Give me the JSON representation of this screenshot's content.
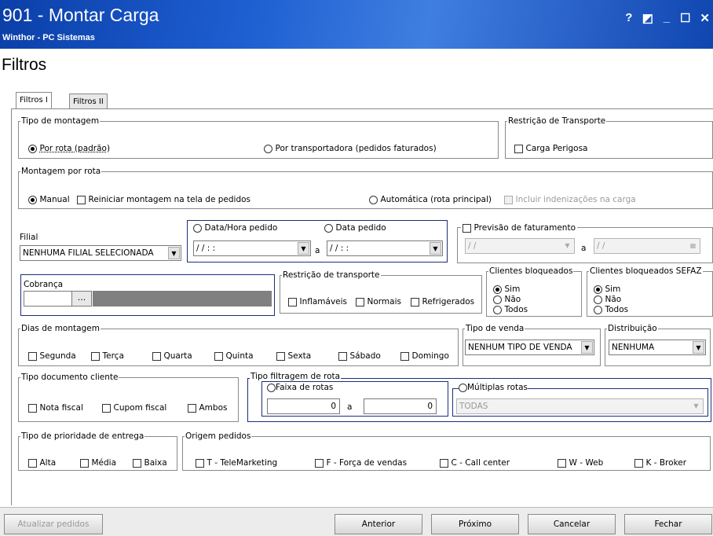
{
  "window": {
    "title": "901 - Montar Carga",
    "subtitle": "Winthor - PC Sistemas",
    "controls": [
      "?",
      "◩",
      "_",
      "☐",
      "✕"
    ]
  },
  "page_title": "Filtros",
  "tabs": [
    "Filtros I",
    "Filtros II"
  ],
  "tipo_montagem": {
    "legend": "Tipo de montagem",
    "opt_rota": "Por rota (padrão)",
    "opt_transp": "Por transportadora (pedidos faturados)"
  },
  "restricao_transporte_top": {
    "legend": "Restrição de Transporte",
    "carga_perigosa": "Carga Perigosa"
  },
  "montagem_rota": {
    "legend": "Montagem por rota",
    "manual": "Manual",
    "reiniciar": "Reiniciar montagem na tela de pedidos",
    "automatica": "Automática (rota principal)",
    "incluir": "Incluir indenizações na carga"
  },
  "filial": {
    "label": "Filial",
    "value": "NENHUMA FILIAL SELECIONADA"
  },
  "data": {
    "opt_datahora": "Data/Hora pedido",
    "opt_data": "Data pedido",
    "from": "/ /   : :",
    "to": "/ /   : :",
    "a": "a"
  },
  "previsao": {
    "label": "Previsão de faturamento",
    "from": "/ /",
    "to": "/ /",
    "a": "a"
  },
  "cobranca": {
    "label": "Cobrança",
    "button": "..."
  },
  "restricao_transporte": {
    "legend": "Restrição de transporte",
    "inflamaveis": "Inflamáveis",
    "normais": "Normais",
    "refrigerados": "Refrigerados"
  },
  "clientes_bloq": {
    "legend": "Clientes bloqueados",
    "sim": "Sim",
    "nao": "Não",
    "todos": "Todos"
  },
  "clientes_bloq_sefaz": {
    "legend": "Clientes bloqueados SEFAZ",
    "sim": "Sim",
    "nao": "Não",
    "todos": "Todos"
  },
  "dias": {
    "legend": "Dias de montagem",
    "items": [
      "Segunda",
      "Terça",
      "Quarta",
      "Quinta",
      "Sexta",
      "Sábado",
      "Domingo"
    ]
  },
  "tipo_venda": {
    "legend": "Tipo de venda",
    "value": "NENHUM TIPO DE VENDA"
  },
  "distribuicao": {
    "legend": "Distribuição",
    "value": "NENHUMA"
  },
  "tipo_doc": {
    "legend": "Tipo documento cliente",
    "nota": "Nota fiscal",
    "cupom": "Cupom fiscal",
    "ambos": "Ambos"
  },
  "filtragem_rota": {
    "legend": "Tipo filtragem de rota",
    "faixa": "Faixa de rotas",
    "from": "0",
    "to": "0",
    "a": "a",
    "multiplas": "Múltiplas rotas",
    "multiplas_value": "TODAS"
  },
  "prioridade": {
    "legend": "Tipo de prioridade de entrega",
    "alta": "Alta",
    "media": "Média",
    "baixa": "Baixa"
  },
  "origem": {
    "legend": "Origem pedidos",
    "items": [
      "T - TeleMarketing",
      "F - Força de vendas",
      "C - Call center",
      "W - Web",
      "K - Broker"
    ]
  },
  "buttons": {
    "atualizar": "Atualizar pedidos",
    "anterior": "Anterior",
    "proximo": "Próximo",
    "cancelar": "Cancelar",
    "fechar": "Fechar"
  }
}
